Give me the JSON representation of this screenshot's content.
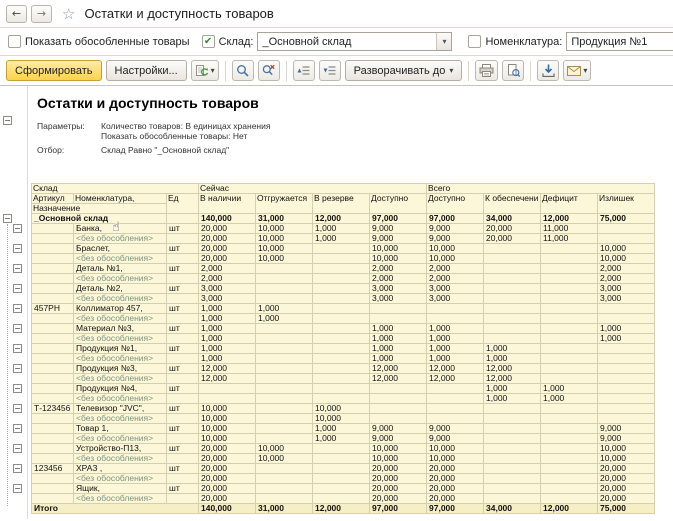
{
  "glyphs": {
    "caret": "▾",
    "back_arrow": "←",
    "forward_arrow": "→",
    "star": "☆",
    "check": "✔",
    "minus": "−",
    "cursor": "☝"
  },
  "window": {
    "title": "Остатки и доступность товаров"
  },
  "filters": {
    "show_separated": {
      "label": "Показать обособленные товары",
      "checked": false
    },
    "warehouse": {
      "label": "Склад:",
      "checked": true,
      "value": "_Основной склад"
    },
    "nomenclature": {
      "label": "Номенклатура:",
      "checked": false,
      "value": "Продукция №1"
    }
  },
  "toolbar": {
    "generate_label": "Сформировать",
    "settings_label": "Настройки...",
    "expand_to_label": "Разворачивать до"
  },
  "report": {
    "title": "Остатки и доступность товаров",
    "params_label": "Параметры:",
    "params_line1": "Количество товаров: В единицах хранения",
    "params_line2": "Показать обособленные товары: Нет",
    "filter_label": "Отбор:",
    "filter_value": "Склад Равно \"_Основной склад\""
  },
  "table": {
    "headers": {
      "warehouse": "Склад",
      "now": "Сейчас",
      "total": "Всего",
      "article": "Артикул",
      "nomenclature": "Номенклатура,",
      "purpose": "Назначение",
      "unit": "Ед",
      "in_stock": "В наличии",
      "shipping": "Отгружается",
      "reserved": "В резерве",
      "available_now": "Доступно",
      "available_total": "Доступно",
      "to_supply": "К обеспечени",
      "deficit": "Дефицит",
      "surplus": "Излишек"
    },
    "rows": [
      {
        "type": "warehouse",
        "name": "_Основной склад",
        "vals": [
          "140,000",
          "31,000",
          "12,000",
          "97,000",
          "97,000",
          "34,000",
          "12,000",
          "75,000"
        ]
      },
      {
        "type": "item",
        "article": "",
        "name": "Банка,",
        "unit": "шт",
        "vals": [
          "20,000",
          "10,000",
          "1,000",
          "9,000",
          "9,000",
          "20,000",
          "11,000",
          ""
        ]
      },
      {
        "type": "detail",
        "name": "<без обособления>",
        "vals": [
          "20,000",
          "10,000",
          "1,000",
          "9,000",
          "9,000",
          "20,000",
          "11,000",
          ""
        ]
      },
      {
        "type": "item",
        "article": "",
        "name": "Браслет,",
        "unit": "шт",
        "vals": [
          "20,000",
          "10,000",
          "",
          "10,000",
          "10,000",
          "",
          "",
          "10,000"
        ]
      },
      {
        "type": "detail",
        "name": "<без обособления>",
        "vals": [
          "20,000",
          "10,000",
          "",
          "10,000",
          "10,000",
          "",
          "",
          "10,000"
        ]
      },
      {
        "type": "item",
        "article": "",
        "name": "Деталь №1,",
        "unit": "шт",
        "vals": [
          "2,000",
          "",
          "",
          "2,000",
          "2,000",
          "",
          "",
          "2,000"
        ]
      },
      {
        "type": "detail",
        "name": "<без обособления>",
        "vals": [
          "2,000",
          "",
          "",
          "2,000",
          "2,000",
          "",
          "",
          "2,000"
        ]
      },
      {
        "type": "item",
        "article": "",
        "name": "Деталь №2,",
        "unit": "шт",
        "vals": [
          "3,000",
          "",
          "",
          "3,000",
          "3,000",
          "",
          "",
          "3,000"
        ]
      },
      {
        "type": "detail",
        "name": "<без обособления>",
        "vals": [
          "3,000",
          "",
          "",
          "3,000",
          "3,000",
          "",
          "",
          "3,000"
        ]
      },
      {
        "type": "item",
        "article": "457РН",
        "name": "Коллиматор 457,",
        "unit": "шт",
        "vals": [
          "1,000",
          "1,000",
          "",
          "",
          "",
          "",
          "",
          ""
        ]
      },
      {
        "type": "detail",
        "name": "<без обособления>",
        "vals": [
          "1,000",
          "1,000",
          "",
          "",
          "",
          "",
          "",
          ""
        ]
      },
      {
        "type": "item",
        "article": "",
        "name": "Материал №3,",
        "unit": "шт",
        "vals": [
          "1,000",
          "",
          "",
          "1,000",
          "1,000",
          "",
          "",
          "1,000"
        ]
      },
      {
        "type": "detail",
        "name": "<без обособления>",
        "vals": [
          "1,000",
          "",
          "",
          "1,000",
          "1,000",
          "",
          "",
          "1,000"
        ]
      },
      {
        "type": "item",
        "article": "",
        "name": "Продукция №1,",
        "unit": "шт",
        "vals": [
          "1,000",
          "",
          "",
          "1,000",
          "1,000",
          "1,000",
          "",
          ""
        ]
      },
      {
        "type": "detail",
        "name": "<без обособления>",
        "vals": [
          "1,000",
          "",
          "",
          "1,000",
          "1,000",
          "1,000",
          "",
          ""
        ]
      },
      {
        "type": "item",
        "article": "",
        "name": "Продукция №3,",
        "unit": "шт",
        "vals": [
          "12,000",
          "",
          "",
          "12,000",
          "12,000",
          "12,000",
          "",
          ""
        ]
      },
      {
        "type": "detail",
        "name": "<без обособления>",
        "vals": [
          "12,000",
          "",
          "",
          "12,000",
          "12,000",
          "12,000",
          "",
          ""
        ]
      },
      {
        "type": "item",
        "article": "",
        "name": "Продукция №4,",
        "unit": "шт",
        "vals": [
          "",
          "",
          "",
          "",
          "",
          "1,000",
          "1,000",
          ""
        ]
      },
      {
        "type": "detail",
        "name": "<без обособления>",
        "vals": [
          "",
          "",
          "",
          "",
          "",
          "1,000",
          "1,000",
          ""
        ]
      },
      {
        "type": "item",
        "article": "Т-123456",
        "name": "Телевизор \"JVC\",",
        "unit": "шт",
        "vals": [
          "10,000",
          "",
          "10,000",
          "",
          "",
          "",
          "",
          ""
        ]
      },
      {
        "type": "detail",
        "name": "<без обособления>",
        "vals": [
          "10,000",
          "",
          "10,000",
          "",
          "",
          "",
          "",
          ""
        ]
      },
      {
        "type": "item",
        "article": "",
        "name": "Товар 1,",
        "unit": "шт",
        "vals": [
          "10,000",
          "",
          "1,000",
          "9,000",
          "9,000",
          "",
          "",
          "9,000"
        ]
      },
      {
        "type": "detail",
        "name": "<без обособления>",
        "vals": [
          "10,000",
          "",
          "1,000",
          "9,000",
          "9,000",
          "",
          "",
          "9,000"
        ]
      },
      {
        "type": "item",
        "article": "",
        "name": "Устройство-П13,",
        "unit": "шт",
        "vals": [
          "20,000",
          "10,000",
          "",
          "10,000",
          "10,000",
          "",
          "",
          "10,000"
        ]
      },
      {
        "type": "detail",
        "name": "<без обособления>",
        "vals": [
          "20,000",
          "10,000",
          "",
          "10,000",
          "10,000",
          "",
          "",
          "10,000"
        ]
      },
      {
        "type": "item",
        "article": "123456",
        "name": "ХРАЗ ,",
        "unit": "шт",
        "vals": [
          "20,000",
          "",
          "",
          "20,000",
          "20,000",
          "",
          "",
          "20,000"
        ]
      },
      {
        "type": "detail",
        "name": "<без обособления>",
        "vals": [
          "20,000",
          "",
          "",
          "20,000",
          "20,000",
          "",
          "",
          "20,000"
        ]
      },
      {
        "type": "item",
        "article": "",
        "name": "Ящик,",
        "unit": "шт",
        "vals": [
          "20,000",
          "",
          "",
          "20,000",
          "20,000",
          "",
          "",
          "20,000"
        ]
      },
      {
        "type": "detail",
        "name": "<без обособления>",
        "vals": [
          "20,000",
          "",
          "",
          "20,000",
          "20,000",
          "",
          "",
          "20,000"
        ]
      },
      {
        "type": "total",
        "name": "Итого",
        "vals": [
          "140,000",
          "31,000",
          "12,000",
          "97,000",
          "97,000",
          "34,000",
          "12,000",
          "75,000"
        ]
      }
    ]
  }
}
